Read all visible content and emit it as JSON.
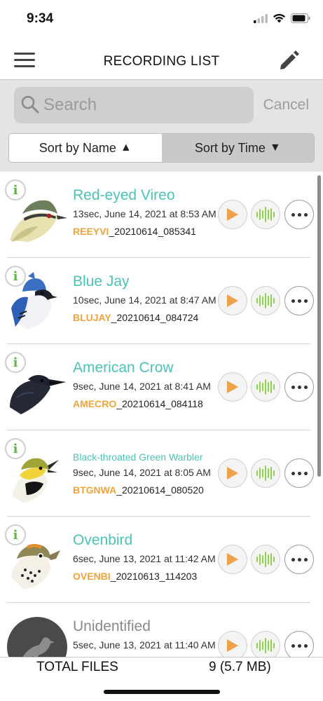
{
  "status_bar": {
    "time": "9:34"
  },
  "nav": {
    "title": "RECORDING LIST"
  },
  "search": {
    "placeholder": "Search",
    "cancel_label": "Cancel"
  },
  "sort": {
    "by_name_label": "Sort by Name",
    "by_name_arrow": "▲",
    "by_time_label": "Sort by Time",
    "by_time_arrow": "▼",
    "active": "name"
  },
  "recordings": [
    {
      "name": "Red-eyed Vireo",
      "meta": "13sec, June 14, 2021 at 8:53 AM",
      "code": "REEYVI",
      "file_suffix": "_20210614_085341"
    },
    {
      "name": "Blue Jay",
      "meta": "10sec, June 14, 2021 at 8:47 AM",
      "code": "BLUJAY",
      "file_suffix": "_20210614_084724"
    },
    {
      "name": "American Crow",
      "meta": "9sec, June 14, 2021 at 8:41 AM",
      "code": "AMECRO",
      "file_suffix": "_20210614_084118"
    },
    {
      "name": "Black-throated Green Warbler",
      "meta": "9sec, June 14, 2021 at 8:05 AM",
      "code": "BTGNWA",
      "file_suffix": "_20210614_080520"
    },
    {
      "name": "Ovenbird",
      "meta": "6sec, June 13, 2021 at 11:42 AM",
      "code": "OVENBI",
      "file_suffix": "_20210613_114203"
    },
    {
      "name": "Unidentified",
      "meta": "5sec, June 13, 2021 at 11:40 AM",
      "code": "",
      "file_suffix": ""
    }
  ],
  "info_symbol": "i",
  "footer": {
    "label": "TOTAL FILES",
    "value": "9 (5.7 MB)"
  },
  "colors": {
    "name_teal": "#4cc3b6",
    "code_orange": "#f0a53c",
    "play_orange": "#f0a24a",
    "wave_green": "#8fd14f",
    "info_green": "#5cb83d"
  }
}
